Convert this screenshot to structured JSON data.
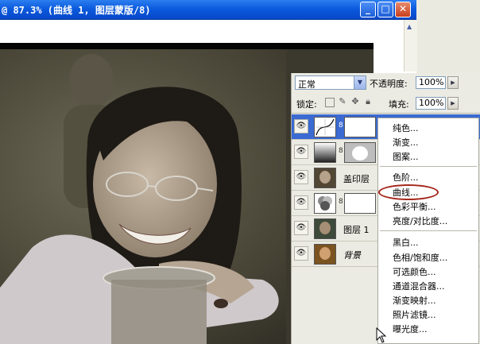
{
  "window": {
    "title": "@ 87.3% (曲线 1, 图层蒙版/8)",
    "minimize_glyph": "_",
    "maximize_glyph": "□",
    "close_glyph": "✕"
  },
  "panel": {
    "blend_mode": "正常",
    "opacity_label": "不透明度:",
    "opacity_value": "100%",
    "lock_label": "锁定:",
    "fill_label": "填充:",
    "fill_value": "100%"
  },
  "layers": [
    {
      "name": "",
      "type": "curves-adjustment",
      "selected": true,
      "visible": true
    },
    {
      "name": "",
      "type": "gradient-map-adjustment",
      "selected": false,
      "visible": true
    },
    {
      "name": "盖印层",
      "type": "pixel",
      "selected": false,
      "visible": true
    },
    {
      "name": "",
      "type": "hue-saturation-adjustment",
      "selected": false,
      "visible": true
    },
    {
      "name": "图层 1",
      "type": "pixel",
      "selected": false,
      "visible": true
    },
    {
      "name": "背景",
      "type": "background",
      "selected": false,
      "visible": true
    }
  ],
  "menu": {
    "group1": [
      "纯色...",
      "渐变...",
      "图案..."
    ],
    "group2": [
      "色阶...",
      "曲线...",
      "色彩平衡...",
      "亮度/对比度..."
    ],
    "group3": [
      "黑白...",
      "色相/饱和度...",
      "可选颜色...",
      "通道混合器...",
      "渐变映射...",
      "照片滤镜...",
      "曝光度..."
    ],
    "highlighted": "曲线..."
  },
  "colors": {
    "titlebar": "#0a58dc",
    "selection": "#3a6ad2",
    "highlight_oval": "#a5271c"
  }
}
